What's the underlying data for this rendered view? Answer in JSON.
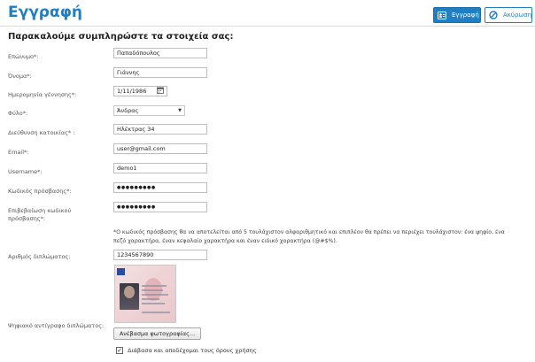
{
  "header": {
    "title": "Εγγραφή",
    "register_label": "Εγγραφή",
    "cancel_label": "Ακύρωση"
  },
  "form": {
    "subtitle": "Παρακαλούμε συμπληρώστε τα στοιχεία σας:",
    "fields": {
      "surname": {
        "label": "Επώνυμο*:",
        "value": "Παπαδόπουλος"
      },
      "firstname": {
        "label": "Όνομα*:",
        "value": "Γιάννης"
      },
      "birthdate": {
        "label": "Ημερομηνία γέννησης*:",
        "value": "1/11/1986"
      },
      "gender": {
        "label": "Φύλο*:",
        "value": "Άνδρας"
      },
      "address": {
        "label": "Διεύθυνση κατοικίας* :",
        "value": "Ηλέκτρας 34"
      },
      "email": {
        "label": "Email*:",
        "value": "user@gmail.com"
      },
      "username": {
        "label": "Username*:",
        "value": "demo1"
      },
      "password": {
        "label": "Κωδικός πρόσβασης*:",
        "value": "●●●●●●●●●"
      },
      "password_confirm": {
        "label": "Επιβεβαίωση κωδικού πρόσβασης*:",
        "value": "●●●●●●●●●"
      },
      "license_number": {
        "label": "Αριθμός διπλώματος:",
        "value": "1234567890"
      }
    },
    "password_note_line1": "*Ο κωδικός πρόσβασης θα να αποτελείται από 5 τουλάχιστον αλφαριθμητικό και επιπλέον θα πρέπει να περιέχει τουλάχιστον: ένα ψηφίο, ένα",
    "password_note_line2": "πεζό χαρακτήρα, έναν κεφαλαίο χαρακτήρα και έναν ειδικό χαρακτήρα (@#$%).",
    "license_copy_label": "Ψηφιακό αντίγραφο διπλώματος:",
    "upload_label": "Ανέβασμα φωτογραφίας...",
    "terms_label": "Διάβασα και αποδέχομαι τους όρους χρήσης",
    "terms_checked": true
  },
  "icons": {
    "register": "user-card-icon",
    "cancel": "cancel-circle-icon",
    "calendar": "calendar-icon",
    "dropdown": "chevron-down-icon"
  },
  "colors": {
    "accent": "#1e7fc2"
  }
}
